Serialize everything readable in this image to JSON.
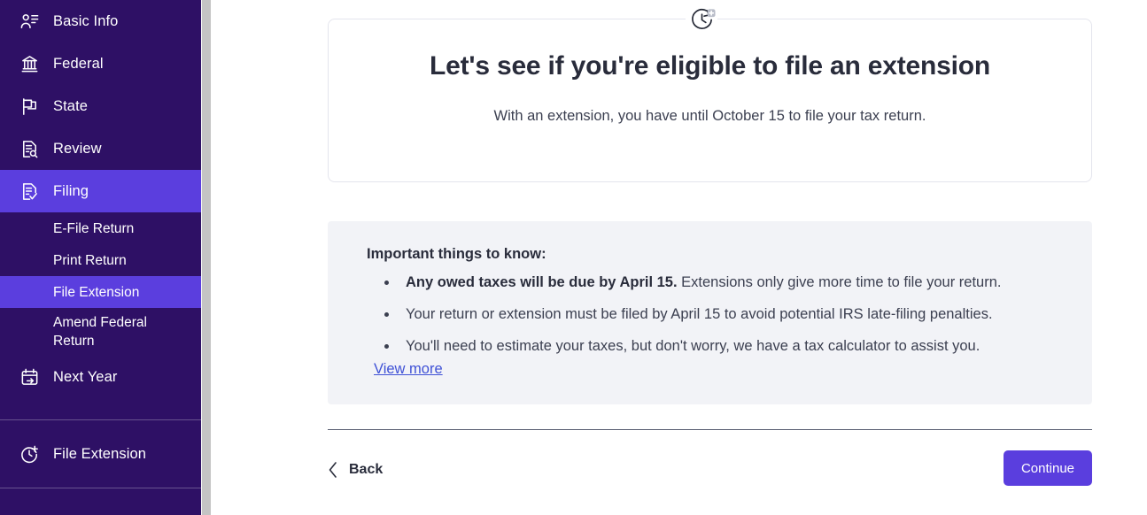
{
  "sidebar": {
    "background_color": "#2E1065",
    "active_color": "#5B3EDE",
    "items": [
      {
        "label": "Basic Info",
        "icon": "person-list-icon",
        "active": false
      },
      {
        "label": "Federal",
        "icon": "government-building-icon",
        "active": false
      },
      {
        "label": "State",
        "icon": "flag-icon",
        "active": false
      },
      {
        "label": "Review",
        "icon": "document-search-icon",
        "active": false
      },
      {
        "label": "Filing",
        "icon": "document-check-icon",
        "active": true
      }
    ],
    "sub_items": [
      {
        "label": "E-File Return",
        "active": false
      },
      {
        "label": "Print Return",
        "active": false
      },
      {
        "label": "File Extension",
        "active": true
      },
      {
        "label": "Amend Federal Return",
        "active": false
      }
    ],
    "next_year": {
      "label": "Next Year",
      "icon": "calendar-arrow-icon"
    },
    "footer_item": {
      "label": "File Extension",
      "icon": "clock-plus-icon"
    }
  },
  "hero": {
    "icon": "clock-plus-badge-icon",
    "title": "Let's see if you're eligible to file an extension",
    "subtitle": "With an extension, you have until October 15 to file your tax return."
  },
  "info": {
    "title": "Important things to know:",
    "bullets": [
      {
        "bold": "Any owed taxes will be due by April 15.",
        "rest": " Extensions only give more time to file your return."
      },
      {
        "bold": "",
        "rest": "Your return or extension must be filed by April 15 to avoid potential IRS late-filing penalties."
      },
      {
        "bold": "",
        "rest": "You'll need to estimate your taxes, but don't worry, we have a tax calculator to assist you."
      }
    ],
    "view_more_label": "View more",
    "link_color": "#3f51d6",
    "panel_color": "#f2f3f7"
  },
  "footer": {
    "back_label": "Back",
    "continue_label": "Continue",
    "continue_color": "#5A3EDE"
  }
}
